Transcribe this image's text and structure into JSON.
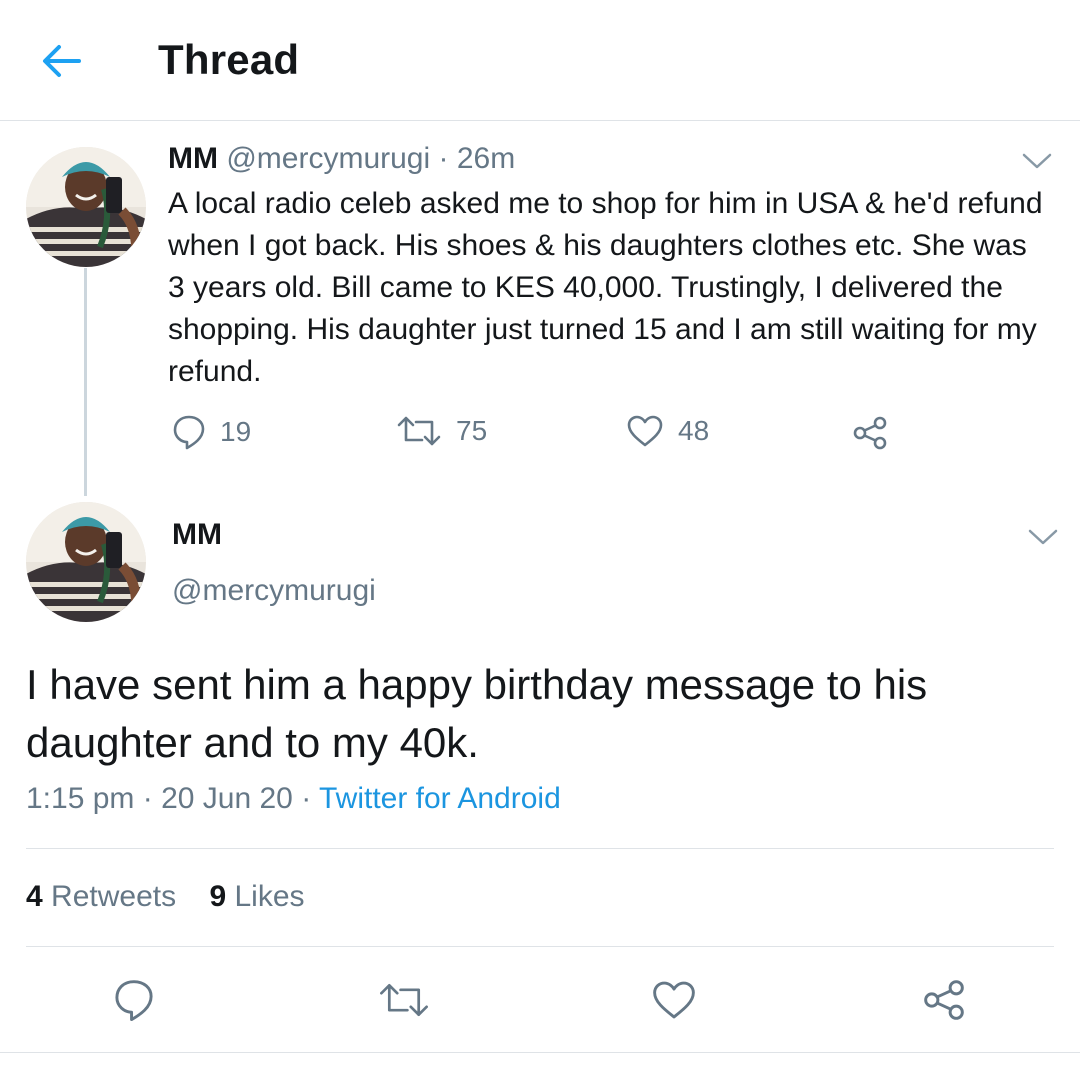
{
  "header": {
    "title": "Thread",
    "back_icon": "back-arrow-icon",
    "accent_color": "#1da1f2"
  },
  "tweet1": {
    "name": "MM",
    "handle": "@mercymurugi",
    "time": "26m",
    "separator": "·",
    "text": "A local radio celeb asked me to shop for him in USA & he'd refund when I got back. His shoes & his daughters clothes etc. She was 3 years old. Bill came to KES 40,000. Trustingly, I delivered the shopping. His daughter just turned 15 and I am still waiting for my refund.",
    "actions": {
      "reply_count": "19",
      "retweet_count": "75",
      "like_count": "48"
    }
  },
  "tweet2": {
    "name": "MM",
    "handle": "@mercymurugi",
    "text": "I have sent him a happy birthday message to his daughter and to my 40k.",
    "meta": {
      "time": "1:15 pm",
      "date": "20 Jun 20",
      "source": "Twitter for Android",
      "sep1": " · ",
      "sep2": " · "
    },
    "stats": {
      "retweets_count": "4",
      "retweets_label": "Retweets",
      "likes_count": "9",
      "likes_label": "Likes"
    }
  },
  "colors": {
    "text": "#14171a",
    "secondary": "#657786",
    "link": "#1b95e0",
    "border": "#dfe3e7"
  }
}
